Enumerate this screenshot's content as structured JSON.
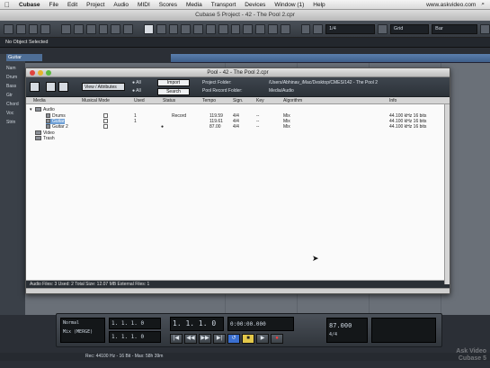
{
  "menubar": {
    "apple": "",
    "app": "Cubase",
    "items": [
      "File",
      "Edit",
      "Project",
      "Audio",
      "MIDI",
      "Scores",
      "Media",
      "Transport",
      "Devices",
      "Window (1)",
      "Help"
    ],
    "right_text": "www.askvideo.com",
    "search_icon": "⌕"
  },
  "window_title": "Cubase 5 Project - 42 - The Pool 2.cpr",
  "toolbar": {
    "quantize_value": "1/4",
    "snap_mode": "Grid",
    "grid_value": "Bar"
  },
  "infoline": "No Object Selected",
  "track_header": "Guitar",
  "side_items": [
    "Nam",
    "Drum",
    "Bass",
    "Gtr",
    "Chord",
    "Voc",
    "Strin"
  ],
  "pool": {
    "title": "Pool - 42 - The Pool 2.cpr",
    "view_attributes": "View / Attributes",
    "radio_all_1": "All",
    "radio_all_2": "All",
    "import_label": "Import",
    "search_label": "Search",
    "project_folder_label": "Project Folder:",
    "project_folder_value": "/Users/Abhinav_iMac/Desktop/CMES/142 - The Pool 2",
    "record_folder_label": "Pool Record Folder:",
    "record_folder_value": "Media/Audio",
    "columns": [
      "Media",
      "Musical Mode",
      "Used",
      "Status",
      "Tempo",
      "Sign.",
      "Key",
      "Algorithm",
      "Info"
    ],
    "rows": [
      {
        "name": "Audio",
        "used": "",
        "status": "",
        "tempo": "",
        "sign": "",
        "key": "",
        "algo": "",
        "info": "",
        "folder": true,
        "indent": 0,
        "record": "",
        "checkbox": false
      },
      {
        "name": "Drums",
        "used": "1",
        "status": "Record",
        "tempo": "119.59",
        "sign": "4/4",
        "key": "--",
        "algo": "Mix",
        "info": "44.100 kHz  16 bits",
        "folder": false,
        "indent": 2,
        "record": "",
        "checkbox": true
      },
      {
        "name": "Guitar",
        "used": "1",
        "status": "",
        "tempo": "119.61",
        "sign": "4/4",
        "key": "--",
        "algo": "Mix",
        "info": "44.100 kHz  16 bits",
        "folder": false,
        "indent": 2,
        "record": "",
        "checkbox": true,
        "selected": true
      },
      {
        "name": "Guitar 2",
        "used": "",
        "status": "",
        "tempo": "87.00",
        "sign": "4/4",
        "key": "--",
        "algo": "Mix",
        "info": "44.100 kHz  16 bits",
        "folder": false,
        "indent": 2,
        "record": "●",
        "checkbox": true
      },
      {
        "name": "Video",
        "used": "",
        "status": "",
        "tempo": "",
        "sign": "",
        "key": "",
        "algo": "",
        "info": "",
        "folder": true,
        "indent": 0,
        "record": "",
        "checkbox": false
      },
      {
        "name": "Trash",
        "used": "",
        "status": "",
        "tempo": "",
        "sign": "",
        "key": "",
        "algo": "",
        "info": "",
        "folder": true,
        "indent": 0,
        "record": "",
        "checkbox": false
      }
    ],
    "status": "Audio Files: 3    Used: 2    Total Size: 12.07 MB    External Files: 1"
  },
  "transport": {
    "mode_1": "Normal",
    "mode_2": "Mix (MERGE)",
    "position_left": "1. 1. 1.  0",
    "position_right": "1. 1. 1.  0",
    "main_position": "1. 1. 1.  0",
    "time": "0:00:00.000",
    "tempo": "87.000",
    "signature": "4/4",
    "buttons": [
      "|◀",
      "◀◀",
      "▶▶",
      "▶|",
      "↺",
      "■",
      "▶",
      "●"
    ]
  },
  "statusbar": "Rec: 44100 Hz - 16 Bit - Max: 58h 39m",
  "watermark": [
    "Ask Video",
    "Cubase 5"
  ]
}
